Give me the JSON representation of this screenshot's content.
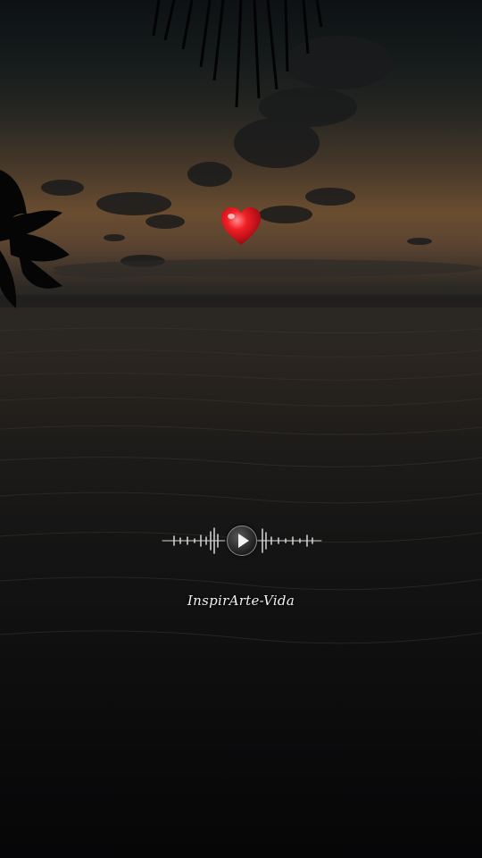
{
  "media": {
    "watermark_text": "InspirArte-Vida",
    "play_icon": "play-icon",
    "heart_icon": "heart-icon",
    "accent_color": "#e3141c"
  }
}
